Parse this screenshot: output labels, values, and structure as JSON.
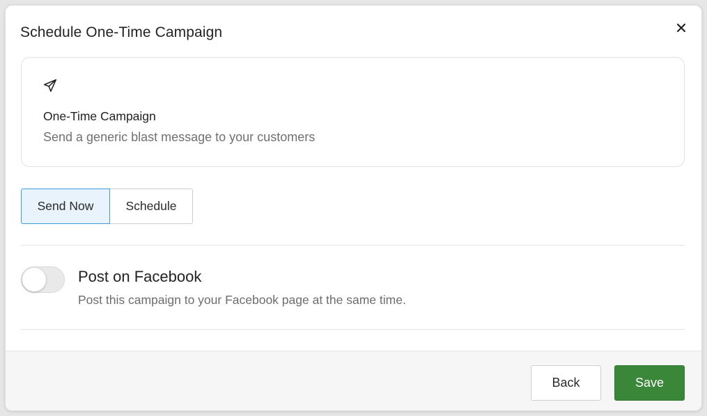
{
  "modal": {
    "title": "Schedule One-Time Campaign",
    "close_icon": "close-icon"
  },
  "campaign_card": {
    "icon": "paper-plane-icon",
    "title": "One-Time Campaign",
    "description": "Send a generic blast message to your customers"
  },
  "send_mode": {
    "options": [
      "Send Now",
      "Schedule"
    ],
    "selected": "Send Now"
  },
  "facebook": {
    "toggle_on": false,
    "title": "Post on Facebook",
    "description": "Post this campaign to your Facebook page at the same time."
  },
  "footer": {
    "back_label": "Back",
    "save_label": "Save"
  },
  "colors": {
    "accent_blue": "#3b9ad9",
    "selected_bg": "#e8f3fc",
    "save_green": "#3a873a"
  }
}
